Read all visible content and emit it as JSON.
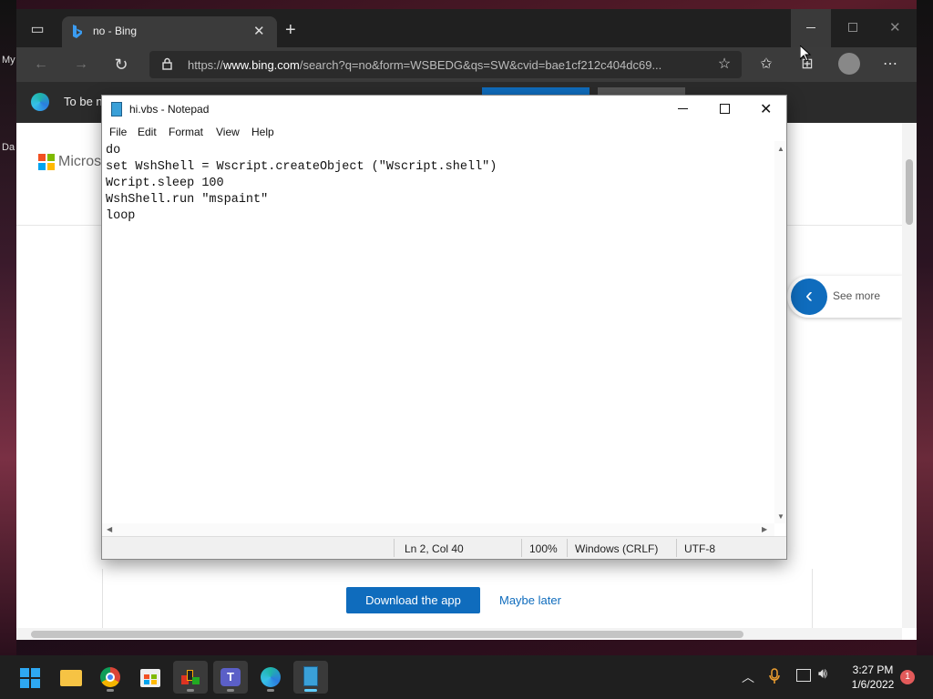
{
  "desktop": {
    "icon_label_1": "My",
    "icon_label_2": "Da"
  },
  "browser": {
    "tab_title": "no - Bing",
    "url_prefix": "https://",
    "url_domain": "www.bing.com",
    "url_rest": "/search?q=no&form=WSBEDG&qs=SW&cvid=bae1cf212c404dc69...",
    "info_bar_text": "To be n",
    "page": {
      "brand_text": "Microso",
      "see_more_label": "See more",
      "download_button": "Download the app",
      "maybe_later_link": "Maybe later"
    }
  },
  "notepad": {
    "title": "hi.vbs - Notepad",
    "menu": [
      "File",
      "Edit",
      "Format",
      "View",
      "Help"
    ],
    "content_lines": [
      "do",
      "set WshShell = Wscript.createObject (\"Wscript.shell\")",
      "Wcript.sleep 100",
      "WshShell.run \"mspaint\"",
      "loop"
    ],
    "status": {
      "position": "Ln 2, Col 40",
      "zoom": "100%",
      "line_endings": "Windows (CRLF)",
      "encoding": "UTF-8"
    }
  },
  "taskbar": {
    "time": "3:27 PM",
    "date": "1/6/2022",
    "notification_count": "1",
    "apps": [
      "start-icon",
      "file-explorer-icon",
      "chrome-icon",
      "store-icon",
      "paint-icon",
      "teams-icon",
      "edge-icon",
      "notepad-icon"
    ]
  },
  "colors": {
    "accent_blue": "#0f6cbd",
    "taskbar": "#1f1f1f",
    "browser_dark": "#202020"
  }
}
